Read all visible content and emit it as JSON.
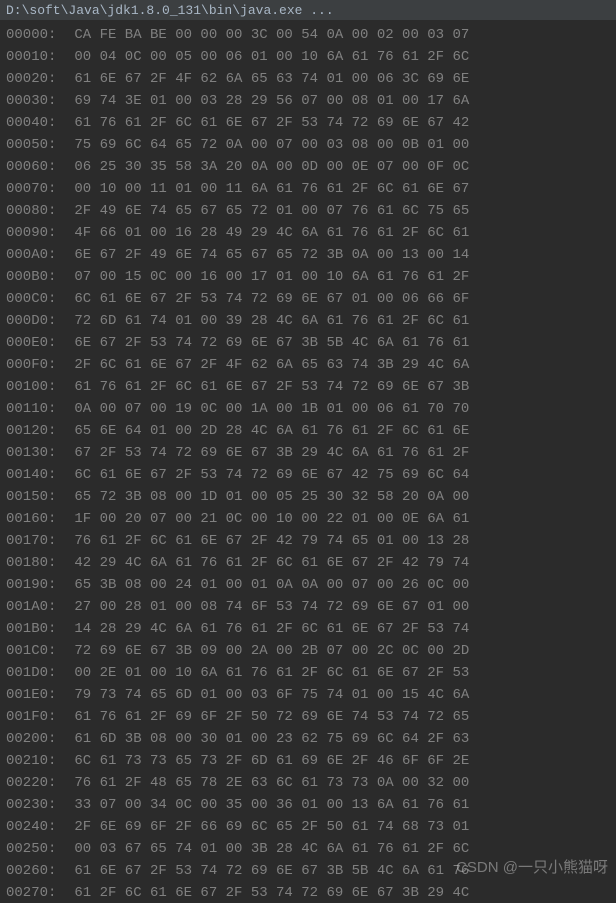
{
  "title": "D:\\soft\\Java\\jdk1.8.0_131\\bin\\java.exe ...",
  "watermark": "CSDN @一只小熊猫呀",
  "hex_rows": [
    {
      "offset": "00000:",
      "bytes": "CA FE BA BE 00 00 00 3C 00 54 0A 00 02 00 03 07"
    },
    {
      "offset": "00010:",
      "bytes": "00 04 0C 00 05 00 06 01 00 10 6A 61 76 61 2F 6C"
    },
    {
      "offset": "00020:",
      "bytes": "61 6E 67 2F 4F 62 6A 65 63 74 01 00 06 3C 69 6E"
    },
    {
      "offset": "00030:",
      "bytes": "69 74 3E 01 00 03 28 29 56 07 00 08 01 00 17 6A"
    },
    {
      "offset": "00040:",
      "bytes": "61 76 61 2F 6C 61 6E 67 2F 53 74 72 69 6E 67 42"
    },
    {
      "offset": "00050:",
      "bytes": "75 69 6C 64 65 72 0A 00 07 00 03 08 00 0B 01 00"
    },
    {
      "offset": "00060:",
      "bytes": "06 25 30 35 58 3A 20 0A 00 0D 00 0E 07 00 0F 0C"
    },
    {
      "offset": "00070:",
      "bytes": "00 10 00 11 01 00 11 6A 61 76 61 2F 6C 61 6E 67"
    },
    {
      "offset": "00080:",
      "bytes": "2F 49 6E 74 65 67 65 72 01 00 07 76 61 6C 75 65"
    },
    {
      "offset": "00090:",
      "bytes": "4F 66 01 00 16 28 49 29 4C 6A 61 76 61 2F 6C 61"
    },
    {
      "offset": "000A0:",
      "bytes": "6E 67 2F 49 6E 74 65 67 65 72 3B 0A 00 13 00 14"
    },
    {
      "offset": "000B0:",
      "bytes": "07 00 15 0C 00 16 00 17 01 00 10 6A 61 76 61 2F"
    },
    {
      "offset": "000C0:",
      "bytes": "6C 61 6E 67 2F 53 74 72 69 6E 67 01 00 06 66 6F"
    },
    {
      "offset": "000D0:",
      "bytes": "72 6D 61 74 01 00 39 28 4C 6A 61 76 61 2F 6C 61"
    },
    {
      "offset": "000E0:",
      "bytes": "6E 67 2F 53 74 72 69 6E 67 3B 5B 4C 6A 61 76 61"
    },
    {
      "offset": "000F0:",
      "bytes": "2F 6C 61 6E 67 2F 4F 62 6A 65 63 74 3B 29 4C 6A"
    },
    {
      "offset": "00100:",
      "bytes": "61 76 61 2F 6C 61 6E 67 2F 53 74 72 69 6E 67 3B"
    },
    {
      "offset": "00110:",
      "bytes": "0A 00 07 00 19 0C 00 1A 00 1B 01 00 06 61 70 70"
    },
    {
      "offset": "00120:",
      "bytes": "65 6E 64 01 00 2D 28 4C 6A 61 76 61 2F 6C 61 6E"
    },
    {
      "offset": "00130:",
      "bytes": "67 2F 53 74 72 69 6E 67 3B 29 4C 6A 61 76 61 2F"
    },
    {
      "offset": "00140:",
      "bytes": "6C 61 6E 67 2F 53 74 72 69 6E 67 42 75 69 6C 64"
    },
    {
      "offset": "00150:",
      "bytes": "65 72 3B 08 00 1D 01 00 05 25 30 32 58 20 0A 00"
    },
    {
      "offset": "00160:",
      "bytes": "1F 00 20 07 00 21 0C 00 10 00 22 01 00 0E 6A 61"
    },
    {
      "offset": "00170:",
      "bytes": "76 61 2F 6C 61 6E 67 2F 42 79 74 65 01 00 13 28"
    },
    {
      "offset": "00180:",
      "bytes": "42 29 4C 6A 61 76 61 2F 6C 61 6E 67 2F 42 79 74"
    },
    {
      "offset": "00190:",
      "bytes": "65 3B 08 00 24 01 00 01 0A 0A 00 07 00 26 0C 00"
    },
    {
      "offset": "001A0:",
      "bytes": "27 00 28 01 00 08 74 6F 53 74 72 69 6E 67 01 00"
    },
    {
      "offset": "001B0:",
      "bytes": "14 28 29 4C 6A 61 76 61 2F 6C 61 6E 67 2F 53 74"
    },
    {
      "offset": "001C0:",
      "bytes": "72 69 6E 67 3B 09 00 2A 00 2B 07 00 2C 0C 00 2D"
    },
    {
      "offset": "001D0:",
      "bytes": "00 2E 01 00 10 6A 61 76 61 2F 6C 61 6E 67 2F 53"
    },
    {
      "offset": "001E0:",
      "bytes": "79 73 74 65 6D 01 00 03 6F 75 74 01 00 15 4C 6A"
    },
    {
      "offset": "001F0:",
      "bytes": "61 76 61 2F 69 6F 2F 50 72 69 6E 74 53 74 72 65"
    },
    {
      "offset": "00200:",
      "bytes": "61 6D 3B 08 00 30 01 00 23 62 75 69 6C 64 2F 63"
    },
    {
      "offset": "00210:",
      "bytes": "6C 61 73 73 65 73 2F 6D 61 69 6E 2F 46 6F 6F 2E"
    },
    {
      "offset": "00220:",
      "bytes": "76 61 2F 48 65 78 2E 63 6C 61 73 73 0A 00 32 00"
    },
    {
      "offset": "00230:",
      "bytes": "33 07 00 34 0C 00 35 00 36 01 00 13 6A 61 76 61"
    },
    {
      "offset": "00240:",
      "bytes": "2F 6E 69 6F 2F 66 69 6C 65 2F 50 61 74 68 73 01"
    },
    {
      "offset": "00250:",
      "bytes": "00 03 67 65 74 01 00 3B 28 4C 6A 61 76 61 2F 6C"
    },
    {
      "offset": "00260:",
      "bytes": "61 6E 67 2F 53 74 72 69 6E 67 3B 5B 4C 6A 61 76"
    },
    {
      "offset": "00270:",
      "bytes": "61 2F 6C 61 6E 67 2F 53 74 72 69 6E 67 3B 29 4C"
    }
  ]
}
